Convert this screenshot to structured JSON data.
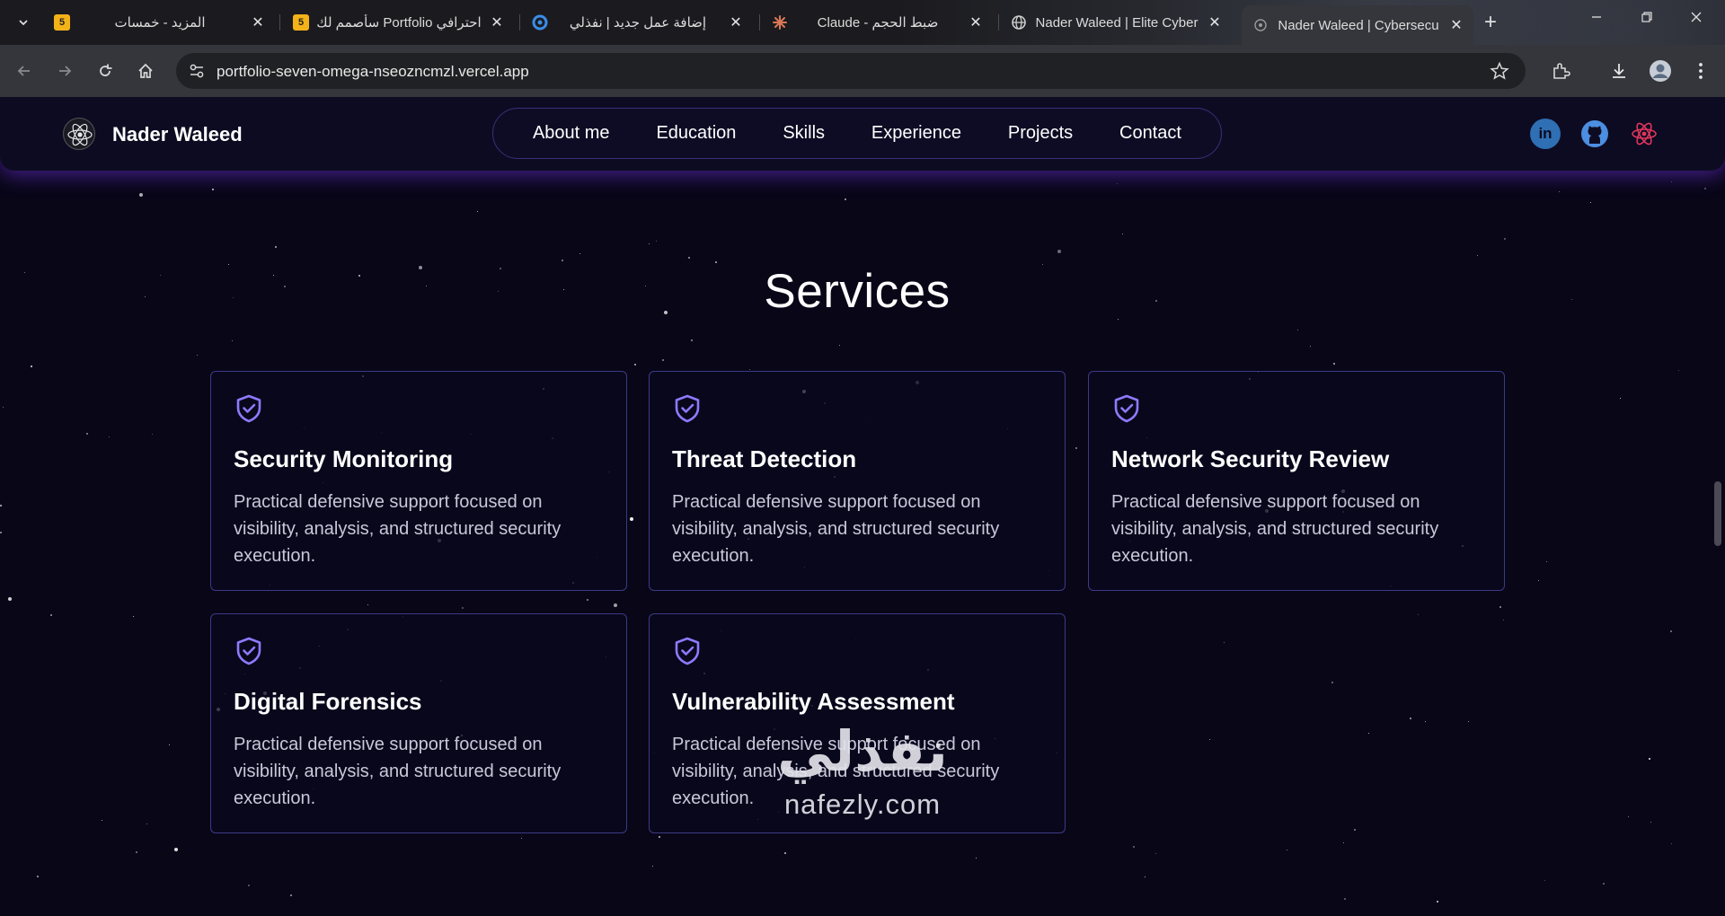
{
  "browser": {
    "tabs": [
      {
        "title": "المزيد - خمسات",
        "favicon": "5"
      },
      {
        "title": "سأصمم لك Portfolio احترافي",
        "favicon": "5"
      },
      {
        "title": "إضافة عمل جديد | نفذلي",
        "favicon": "nafezly-icon"
      },
      {
        "title": "Claude - ضبط الحجم",
        "favicon": "claude-icon"
      },
      {
        "title": "Nader Waleed | Elite Cyber",
        "favicon": "globe-icon"
      },
      {
        "title": "Nader Waleed | Cybersecu",
        "favicon": "site-icon"
      }
    ],
    "close_glyph": "✕",
    "new_tab_glyph": "+",
    "url": "portfolio-seven-omega-nseozncmzl.vercel.app"
  },
  "site": {
    "brand": "Nader Waleed",
    "nav": [
      "About me",
      "Education",
      "Skills",
      "Experience",
      "Projects",
      "Contact"
    ],
    "socials": [
      {
        "name": "linkedin",
        "label": "in",
        "color": "#2f6fb3"
      },
      {
        "name": "github",
        "color": "#4c8ee0"
      },
      {
        "name": "react",
        "color": "#e0365c"
      }
    ],
    "services_heading": "Services",
    "services": [
      {
        "title": "Security Monitoring",
        "desc": "Practical defensive support focused on visibility, analysis, and structured security execution."
      },
      {
        "title": "Threat Detection",
        "desc": "Practical defensive support focused on visibility, analysis, and structured security execution."
      },
      {
        "title": "Network Security Review",
        "desc": "Practical defensive support focused on visibility, analysis, and structured security execution."
      },
      {
        "title": "Digital Forensics",
        "desc": "Practical defensive support focused on visibility, analysis, and structured security execution."
      },
      {
        "title": "Vulnerability Assessment",
        "desc": "Practical defensive support focused on visibility, analysis, and structured security execution."
      }
    ]
  },
  "watermark": {
    "arabic": "نفذلي",
    "latin": "nafezly.com"
  },
  "colors": {
    "accent": "#8b7bff",
    "card_border": "#3c3a86",
    "background": "#080617"
  }
}
